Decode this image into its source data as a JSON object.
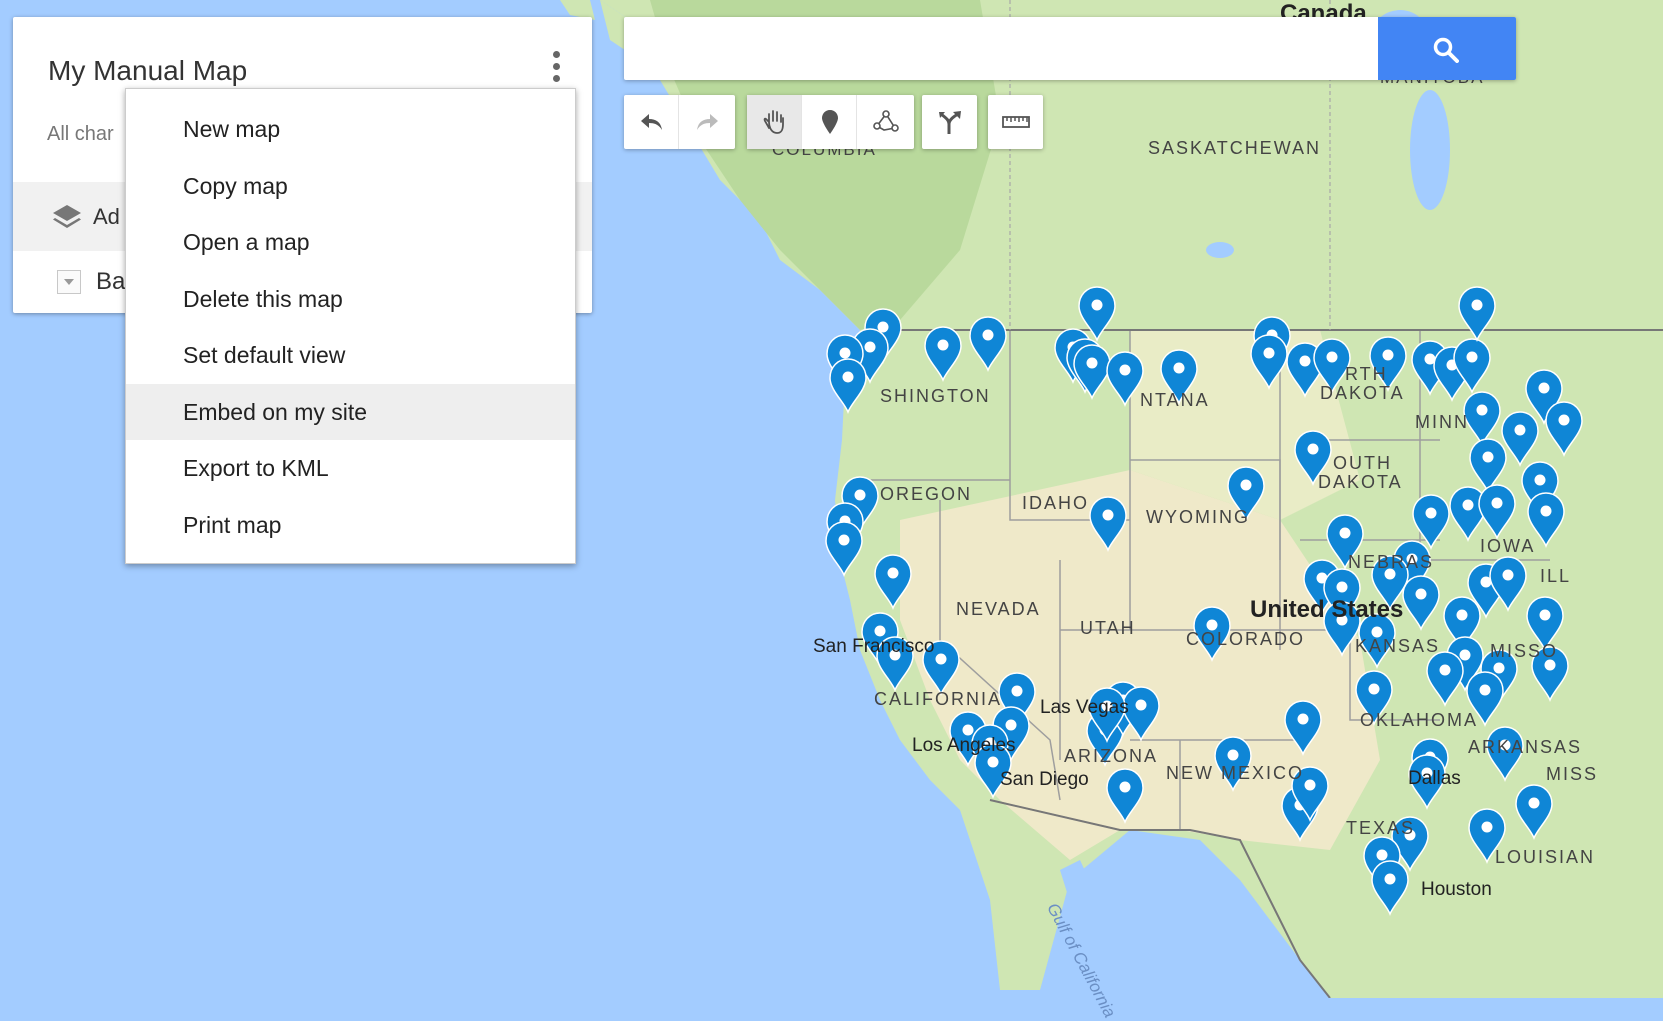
{
  "panel": {
    "title": "My Manual Map",
    "status": "All char",
    "layer_label": "Ad",
    "basemap_label": "Ba"
  },
  "menu": {
    "items": [
      "New map",
      "Copy map",
      "Open a map",
      "Delete this map",
      "Set default view",
      "Embed on my site",
      "Export to KML",
      "Print map"
    ],
    "highlighted": "Embed on my site"
  },
  "search": {
    "value": "",
    "placeholder": ""
  },
  "toolbar": {
    "undo_icon": "undo-icon",
    "redo_icon": "redo-icon",
    "hand_icon": "hand-icon",
    "marker_icon": "marker-icon",
    "line_icon": "draw-line-icon",
    "directions_icon": "directions-icon",
    "ruler_icon": "ruler-icon"
  },
  "map": {
    "labels": {
      "canada": "Canada",
      "manitoba": "MANITOBA",
      "saskatchewan": "SASKATCHEWAN",
      "columbia": "COLUMBIA",
      "washington": "SHINGTON",
      "montana": "NTANA",
      "north_dakota_1": "RTH",
      "north_dakota_2": "DAKOTA",
      "minnesota": "MINN",
      "south_dakota_1": "OUTH",
      "south_dakota_2": "DAKOTA",
      "oregon": "OREGON",
      "idaho": "IDAHO",
      "wyoming": "WYOMING",
      "iowa": "IOWA",
      "illinois": "ILL",
      "nebraska": "NEBRAS",
      "nevada": "NEVADA",
      "utah": "UTAH",
      "united_states": "United States",
      "colorado": "COLORADO",
      "kansas": "KANSAS",
      "missouri": "MISSO",
      "san_francisco": "San Francisco",
      "california": "CALIFORNIA",
      "las_vegas": "Las Vegas",
      "oklahoma": "OKLAHOMA",
      "arkansas": "ARKANSAS",
      "los_angeles": "Los Angeles",
      "arizona": "ARIZONA",
      "san_diego": "San Diego",
      "new_mexico": "NEW MEXICO",
      "dallas": "Dallas",
      "mississippi": "MISS",
      "texas": "TEXAS",
      "louisiana": "LOUISIAN",
      "houston": "Houston",
      "gulf": "Gulf of California"
    },
    "colors": {
      "water": "#a3ccff",
      "land": "#cfe6b3",
      "desert": "#efe9c9",
      "marker": "#0f86d6",
      "highlight": "#eeeeee"
    }
  }
}
